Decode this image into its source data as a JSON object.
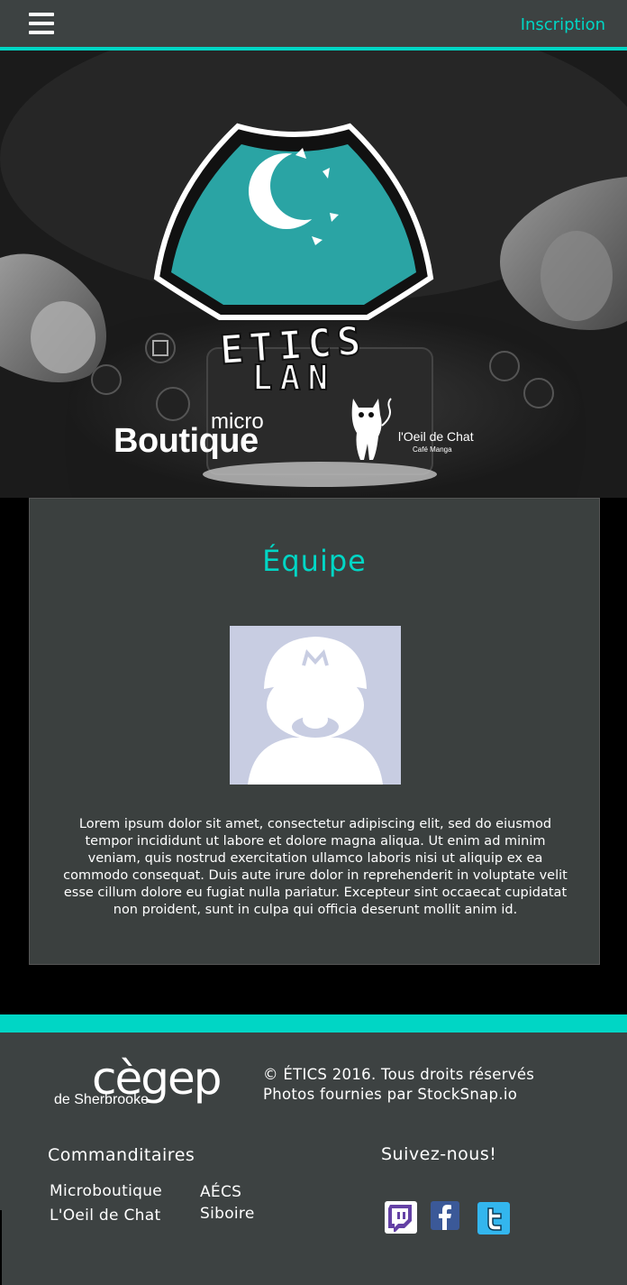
{
  "navbar": {
    "menu_icon": "hamburger-menu-icon",
    "signup_label": "Inscription"
  },
  "hero": {
    "event_logo_text_line1": "ETICS",
    "event_logo_text_line2": "LAN",
    "sponsor_logo_1_small": "micro",
    "sponsor_logo_1_large": "Boutique",
    "sponsor_logo_2_name": "l'Oeil de Chat",
    "sponsor_logo_2_sub": "Café Manga"
  },
  "team": {
    "title": "Équipe",
    "avatar_icon": "mario-silhouette-avatar-icon",
    "description": "Lorem ipsum dolor sit amet, consectetur adipiscing elit, sed do eiusmod tempor incididunt ut labore et dolore magna aliqua. Ut enim ad minim veniam, quis nostrud exercitation ullamco laboris nisi ut aliquip ex ea commodo consequat. Duis aute irure dolor in reprehenderit in voluptate velit esse cillum dolore eu fugiat nulla pariatur. Excepteur sint occaecat cupidatat non proident, sunt in culpa qui officia deserunt mollit anim id."
  },
  "footer": {
    "cegep_logo_main": "cègep",
    "cegep_logo_sub": "de Sherbrooke",
    "copyright_line1": "© ÉTICS 2016. Tous droits réservés",
    "copyright_line2": "Photos fournies par StockSnap.io",
    "sponsors_title": "Commanditaires",
    "sponsors": [
      "Microboutique",
      "AÉCS",
      "L'Oeil de Chat",
      "Siboire"
    ],
    "follow_title": "Suivez-nous!",
    "social_icons": [
      "twitch-icon",
      "facebook-icon",
      "twitter-icon"
    ]
  },
  "colors": {
    "accent": "#00d6c5",
    "panel": "#3d4242",
    "card": "#3b403f",
    "avatar_bg": "#c8cde2"
  }
}
